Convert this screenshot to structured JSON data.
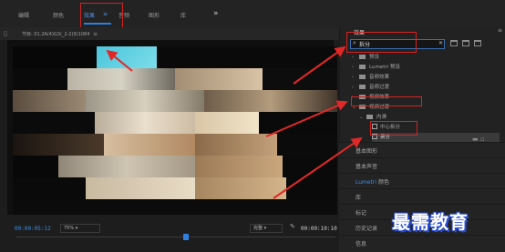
{
  "workspace": {
    "tabs": [
      {
        "label": "编辑"
      },
      {
        "label": "颜色"
      },
      {
        "label": "效果"
      },
      {
        "label": "音频"
      },
      {
        "label": "图形"
      },
      {
        "label": "库"
      }
    ],
    "active_tab_index": 2,
    "more_label": "»",
    "menu_glyph": "≡"
  },
  "program_monitor": {
    "title": "节目: 01.2A(4)G3(_2-2(9)1084",
    "menu_glyph": "≡",
    "timecode_current": "00:00:05:12",
    "zoom": "75%",
    "quality": "完整",
    "timecode_total": "00:00:10:10",
    "playback_position": 0.53
  },
  "effects_panel": {
    "title": "效果",
    "menu_glyph": "≡",
    "search": {
      "value": "拆分"
    },
    "tree": [
      {
        "label": "预设",
        "icon": "folder-icon",
        "expanded": false
      },
      {
        "label": "Lumetri 预设",
        "icon": "folder-icon",
        "expanded": false
      },
      {
        "label": "音频效果",
        "icon": "folder-icon",
        "expanded": false
      },
      {
        "label": "音频过渡",
        "icon": "folder-icon",
        "expanded": false
      },
      {
        "label": "视频效果",
        "icon": "folder-icon",
        "expanded": false
      },
      {
        "label": "视频过渡",
        "icon": "folder-icon",
        "expanded": true
      },
      {
        "label": "内滑",
        "icon": "folder-icon",
        "expanded": true
      },
      {
        "label": "中心拆分",
        "icon": "fx-icon",
        "expanded": false
      },
      {
        "label": "拆分",
        "icon": "fx-icon",
        "expanded": false,
        "selected": true
      }
    ]
  },
  "right_sections": [
    {
      "label": "基本图形"
    },
    {
      "label": "基本声音"
    },
    {
      "label_prefix": "Lumetri",
      "label_suffix": " 颜色"
    },
    {
      "label": "库"
    },
    {
      "label": "标记"
    },
    {
      "label": "历史记录"
    },
    {
      "label": "信息"
    }
  ],
  "watermark": "最需教育",
  "colors": {
    "accent_blue": "#2d7fe3",
    "highlight_red": "#d52222",
    "panel_bg": "#232323"
  }
}
